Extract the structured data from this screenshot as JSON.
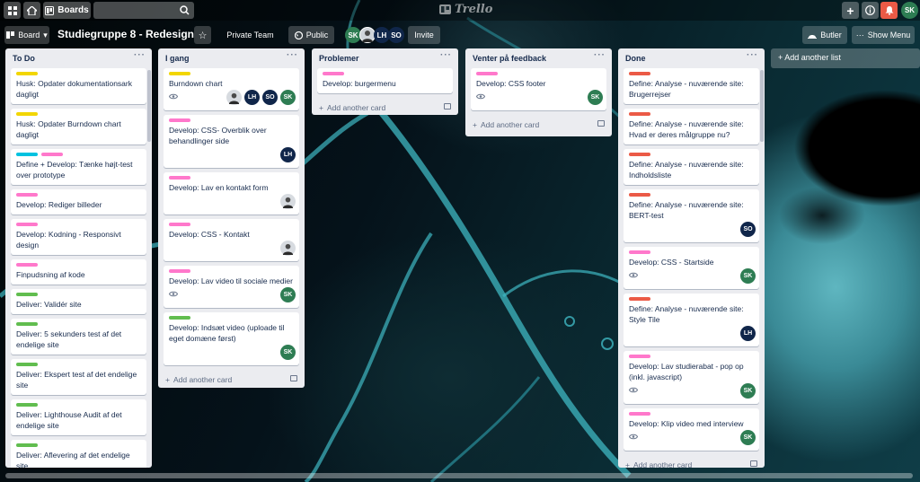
{
  "topbar": {
    "boards_label": "Boards",
    "logo_text": "Trello",
    "user_initials": "SK"
  },
  "boardbar": {
    "board_menu_label": "Board",
    "title": "Studiegruppe 8 - Redesign",
    "team_label": "Private Team",
    "visibility_label": "Public",
    "invite_label": "Invite",
    "butler_label": "Butler",
    "show_menu_label": "Show Menu",
    "members": [
      "SK",
      "",
      "LH",
      "SO"
    ]
  },
  "colors": {
    "yellow": "#f2d600",
    "pink": "#ff78cb",
    "teal": "#00c2e0",
    "green": "#61bd4f",
    "red": "#eb5a46",
    "sk": "#2e7d53",
    "lh": "#10264a",
    "so": "#10264a"
  },
  "add_card_label": "Add another card",
  "add_list_label": "Add another list",
  "lists": [
    {
      "title": "To Do",
      "cards": [
        {
          "labels": [
            "yellow"
          ],
          "title": "Husk: Opdater dokumentationsark dagligt",
          "members": []
        },
        {
          "labels": [
            "yellow"
          ],
          "title": "Husk: Opdater Burndown chart dagligt",
          "members": []
        },
        {
          "labels": [
            "teal",
            "pink"
          ],
          "title": "Define + Develop: Tænke højt-test over prototype",
          "members": []
        },
        {
          "labels": [
            "pink"
          ],
          "title": "Develop: Rediger billeder",
          "members": []
        },
        {
          "labels": [
            "pink"
          ],
          "title": "Develop: Kodning - Responsivt design",
          "members": []
        },
        {
          "labels": [
            "pink"
          ],
          "title": "Finpudsning af kode",
          "members": []
        },
        {
          "labels": [
            "green"
          ],
          "title": "Deliver: Validér site",
          "members": []
        },
        {
          "labels": [
            "green"
          ],
          "title": "Deliver: 5 sekunders test af det endelige site",
          "members": []
        },
        {
          "labels": [
            "green"
          ],
          "title": "Deliver: Ekspert test af det endelige site",
          "members": []
        },
        {
          "labels": [
            "green"
          ],
          "title": "Deliver: Lighthouse Audit af det endelige site",
          "members": []
        },
        {
          "labels": [
            "green"
          ],
          "title": "Deliver: Aflevering af det endelige site",
          "members": []
        }
      ]
    },
    {
      "title": "I gang",
      "cards": [
        {
          "labels": [
            "yellow"
          ],
          "title": "Burndown chart",
          "eye": true,
          "members": [
            "photo",
            "LH",
            "SO",
            "SK"
          ]
        },
        {
          "labels": [
            "pink"
          ],
          "title": "Develop: CSS- Overblik over behandlinger side",
          "members": [
            "LH"
          ]
        },
        {
          "labels": [
            "pink"
          ],
          "title": "Develop: Lav en kontakt form",
          "members": [
            "photo"
          ]
        },
        {
          "labels": [
            "pink"
          ],
          "title": "Develop: CSS - Kontakt",
          "members": [
            "photo"
          ]
        },
        {
          "labels": [
            "pink"
          ],
          "title": "Develop: Lav video til sociale medier",
          "eye": true,
          "members": [
            "SK"
          ]
        },
        {
          "labels": [
            "green"
          ],
          "title": "Develop: Indsæt video (uploade til eget domæne først)",
          "members": [
            "SK"
          ]
        }
      ]
    },
    {
      "title": "Problemer",
      "cards": [
        {
          "labels": [
            "pink"
          ],
          "title": "Develop: burgermenu",
          "members": []
        }
      ]
    },
    {
      "title": "Venter på feedback",
      "cards": [
        {
          "labels": [
            "pink"
          ],
          "title": "Develop: CSS footer",
          "eye": true,
          "members": [
            "SK"
          ]
        }
      ]
    },
    {
      "title": "Done",
      "cards": [
        {
          "labels": [
            "red"
          ],
          "title": "Define: Analyse - nuværende site: Brugerrejser",
          "members": []
        },
        {
          "labels": [
            "red"
          ],
          "title": "Define: Analyse - nuværende site: Hvad er deres målgruppe nu?",
          "members": []
        },
        {
          "labels": [
            "red"
          ],
          "title": "Define: Analyse - nuværende site: Indholdsliste",
          "members": []
        },
        {
          "labels": [
            "red"
          ],
          "title": "Define: Analyse - nuværende site: BERT-test",
          "members": [
            "SO"
          ]
        },
        {
          "labels": [
            "pink"
          ],
          "title": "Develop: CSS - Startside",
          "eye": true,
          "members": [
            "SK"
          ]
        },
        {
          "labels": [
            "red"
          ],
          "title": "Define: Analyse - nuværende site: Style Tile",
          "members": [
            "LH"
          ]
        },
        {
          "labels": [
            "pink"
          ],
          "title": "Develop: Lav studierabat - pop op (inkl. javascript)",
          "eye": true,
          "members": [
            "SK"
          ]
        },
        {
          "labels": [
            "pink"
          ],
          "title": "Develop: Klip video med interview",
          "eye": true,
          "members": [
            "SK"
          ]
        }
      ]
    }
  ]
}
